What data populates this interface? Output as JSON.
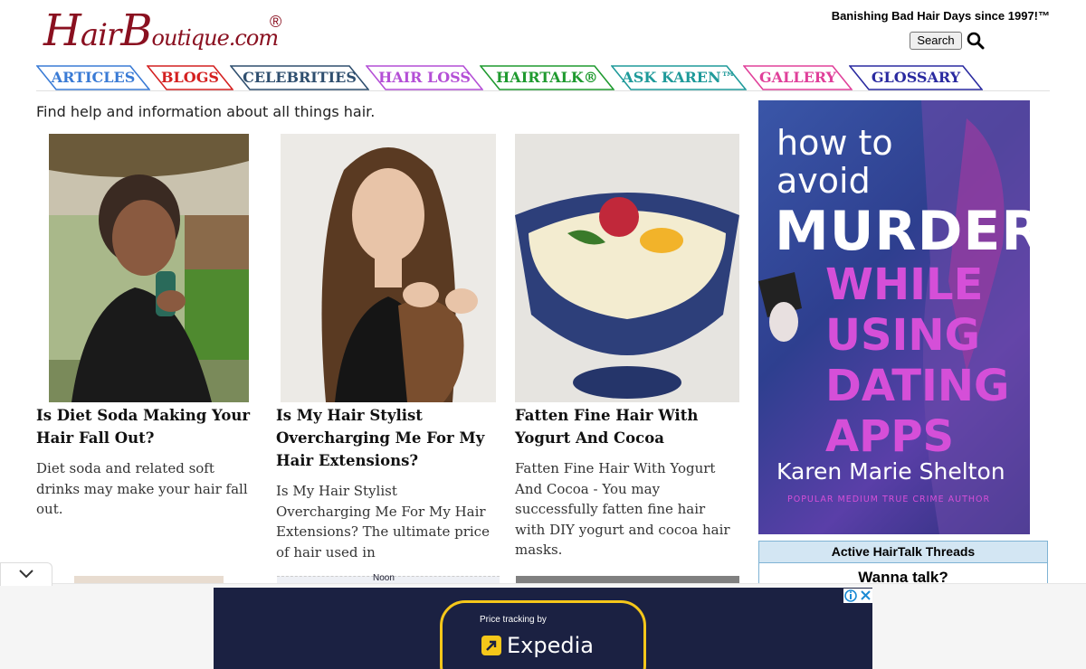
{
  "header": {
    "logo": {
      "h": "H",
      "air": "air",
      "b": "B",
      "outique": "outique.com",
      "reg": "®"
    },
    "tagline": "Banishing Bad Hair Days since 1997!™",
    "search_label": "Search"
  },
  "nav": {
    "tabs": [
      {
        "label": "ARTICLES",
        "color": "#3a7bd5"
      },
      {
        "label": "BLOGS",
        "color": "#d42020"
      },
      {
        "label": "CELEBRITIES",
        "color": "#2f4f6f"
      },
      {
        "label": "HAIR LOSS",
        "color": "#b44fd6"
      },
      {
        "label": "HAIRTALK®",
        "color": "#1f9a2f"
      },
      {
        "label": "ASK KAREN™",
        "color": "#1f9a9a"
      },
      {
        "label": "GALLERY",
        "color": "#e0409a"
      },
      {
        "label": "GLOSSARY",
        "color": "#2a2aa0"
      }
    ]
  },
  "intro": "Find help and information about all things hair.",
  "articles": [
    {
      "title": "Is Diet Soda Making Your Hair Fall Out?",
      "summary": "Diet soda and related soft drinks may make your hair fall out."
    },
    {
      "title": "Is My Hair Stylist Overcharging Me For My Hair Extensions?",
      "summary": "Is My Hair Stylist Overcharging Me For My Hair Extensions? The ultimate price of hair used in"
    },
    {
      "title": "Fatten Fine Hair With Yogurt And Cocoa",
      "summary": "Fatten Fine Hair With Yogurt And Cocoa - You may successfully fatten fine hair with DIY yogurt and cocoa hair masks."
    }
  ],
  "side_ad": {
    "line1": "how to",
    "line2": "avoid",
    "line3": "MURDER",
    "line4": "WHILE",
    "line5": "USING",
    "line6": "DATING",
    "line7": "APPS",
    "author": "Karen Marie Shelton",
    "byline": "POPULAR MEDIUM TRUE CRIME AUTHOR"
  },
  "threads": {
    "header": "Active HairTalk Threads",
    "first": "Wanna talk?"
  },
  "peek": {
    "noon": "Noon"
  },
  "bottom_ad": {
    "tracking": "Price tracking by",
    "brand": "Expedia"
  }
}
